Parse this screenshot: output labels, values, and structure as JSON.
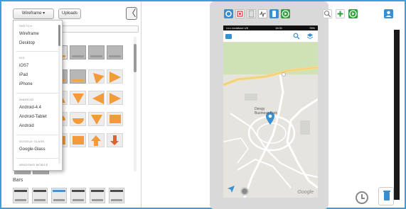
{
  "toolbar": {
    "wireframe_label": "Wireframe ▾",
    "uploads_label": "Uploads",
    "collapse_glyph": "〈"
  },
  "dropdown": {
    "groups": [
      {
        "heading": "SKETCH",
        "items": [
          "Wireframe",
          "Desktop"
        ]
      },
      {
        "heading": "IOS",
        "items": [
          "iOS7",
          "iPad",
          "iPhone"
        ]
      },
      {
        "heading": "ANDROID",
        "items": [
          "Android-4.4",
          "Android-Tablet",
          "Android"
        ]
      },
      {
        "heading": "GOOGLE GLASS",
        "items": [
          "Google-Glass"
        ]
      },
      {
        "heading": "WINDOWS MOBILE",
        "items": []
      }
    ]
  },
  "library": {
    "bars_heading": "Bars"
  },
  "phone": {
    "status_left": "••••• vodafone UK",
    "status_time": "16:31",
    "status_right": "78%",
    "marker_label_line1": "Dengy",
    "marker_label_line2": "Business Park",
    "watermark": "Google"
  },
  "colors": {
    "accent_blue": "#3a8fd0",
    "shape_orange": "#f39a3a",
    "frame_border": "#3aa0d8"
  },
  "icons": {
    "top_toolbar": [
      "settings-icon",
      "record-icon",
      "page-icon",
      "heart-rate-icon",
      "mobile-icon",
      "play-icon"
    ],
    "right_toolbar": [
      "zoom-icon",
      "add-icon",
      "play-icon",
      "user-icon"
    ]
  }
}
